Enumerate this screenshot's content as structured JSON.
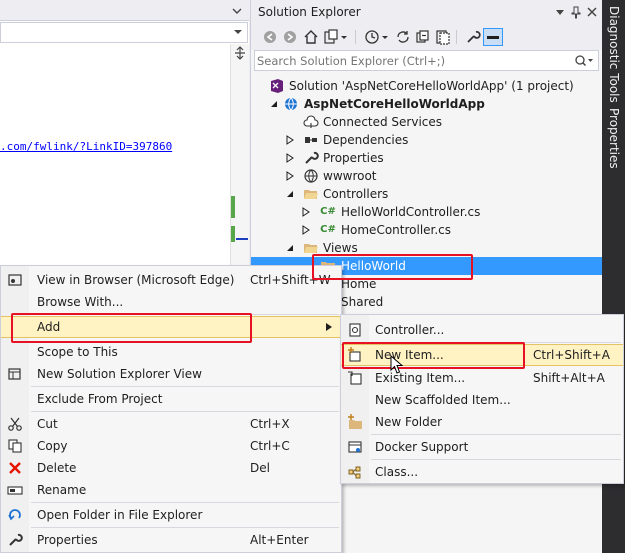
{
  "editor": {
    "link_text": ".com/fwlink/?LinkID=397860"
  },
  "solution_explorer": {
    "title": "Solution Explorer",
    "search_placeholder": "Search Solution Explorer (Ctrl+;)",
    "tree": [
      {
        "label": "Solution 'AspNetCoreHelloWorldApp' (1 project)",
        "icon": "solution-icon"
      },
      {
        "label": "AspNetCoreHelloWorldApp",
        "icon": "web-project-icon",
        "bold": true
      },
      {
        "label": "Connected Services",
        "icon": "cloud-icon"
      },
      {
        "label": "Dependencies",
        "icon": "dependencies-icon"
      },
      {
        "label": "Properties",
        "icon": "wrench-icon"
      },
      {
        "label": "wwwroot",
        "icon": "globe-icon"
      },
      {
        "label": "Controllers",
        "icon": "folder-icon"
      },
      {
        "label": "HelloWorldController.cs",
        "icon": "csharp-file-icon"
      },
      {
        "label": "HomeController.cs",
        "icon": "csharp-file-icon"
      },
      {
        "label": "Views",
        "icon": "folder-icon"
      },
      {
        "label": "HelloWorld",
        "icon": "folder-icon",
        "selected": true
      },
      {
        "label": "Home",
        "icon": "folder-icon"
      },
      {
        "label": "Shared",
        "icon": "folder-icon"
      }
    ]
  },
  "side_tabs": [
    "Diagnostic Tools",
    "Properties"
  ],
  "context_menu": {
    "items": [
      {
        "label": "View in Browser (Microsoft Edge)",
        "shortcut": "Ctrl+Shift+W",
        "icon": "browser-icon"
      },
      {
        "label": "Browse With...",
        "shortcut": "",
        "icon": ""
      },
      {
        "label": "Add",
        "shortcut": "",
        "icon": "",
        "submenu": true,
        "highlighted": true
      },
      {
        "label": "Scope to This",
        "shortcut": "",
        "icon": ""
      },
      {
        "label": "New Solution Explorer View",
        "shortcut": "",
        "icon": "new-window-icon"
      },
      {
        "label": "Exclude From Project",
        "shortcut": "",
        "icon": ""
      },
      {
        "label": "Cut",
        "shortcut": "Ctrl+X",
        "icon": "scissors-icon"
      },
      {
        "label": "Copy",
        "shortcut": "Ctrl+C",
        "icon": "copy-icon"
      },
      {
        "label": "Delete",
        "shortcut": "Del",
        "icon": "delete-x-icon"
      },
      {
        "label": "Rename",
        "shortcut": "",
        "icon": "rename-icon"
      },
      {
        "label": "Open Folder in File Explorer",
        "shortcut": "",
        "icon": "refresh-arrow-icon"
      },
      {
        "label": "Properties",
        "shortcut": "Alt+Enter",
        "icon": "wrench-icon"
      }
    ]
  },
  "add_submenu": {
    "items": [
      {
        "label": "Controller...",
        "shortcut": "",
        "icon": "controller-icon"
      },
      {
        "label": "New Item...",
        "shortcut": "Ctrl+Shift+A",
        "icon": "new-item-icon",
        "highlighted": true
      },
      {
        "label": "Existing Item...",
        "shortcut": "Shift+Alt+A",
        "icon": "existing-item-icon"
      },
      {
        "label": "New Scaffolded Item...",
        "shortcut": "",
        "icon": ""
      },
      {
        "label": "New Folder",
        "shortcut": "",
        "icon": "new-folder-icon"
      },
      {
        "label": "Docker Support",
        "shortcut": "",
        "icon": "docker-icon"
      },
      {
        "label": "Class...",
        "shortcut": "",
        "icon": "class-icon"
      }
    ]
  },
  "colors": {
    "selection": "#3399ff",
    "menu_highlight": "#fff3c4",
    "annotation_red": "#e81123",
    "side_strip": "#2d2d30"
  }
}
